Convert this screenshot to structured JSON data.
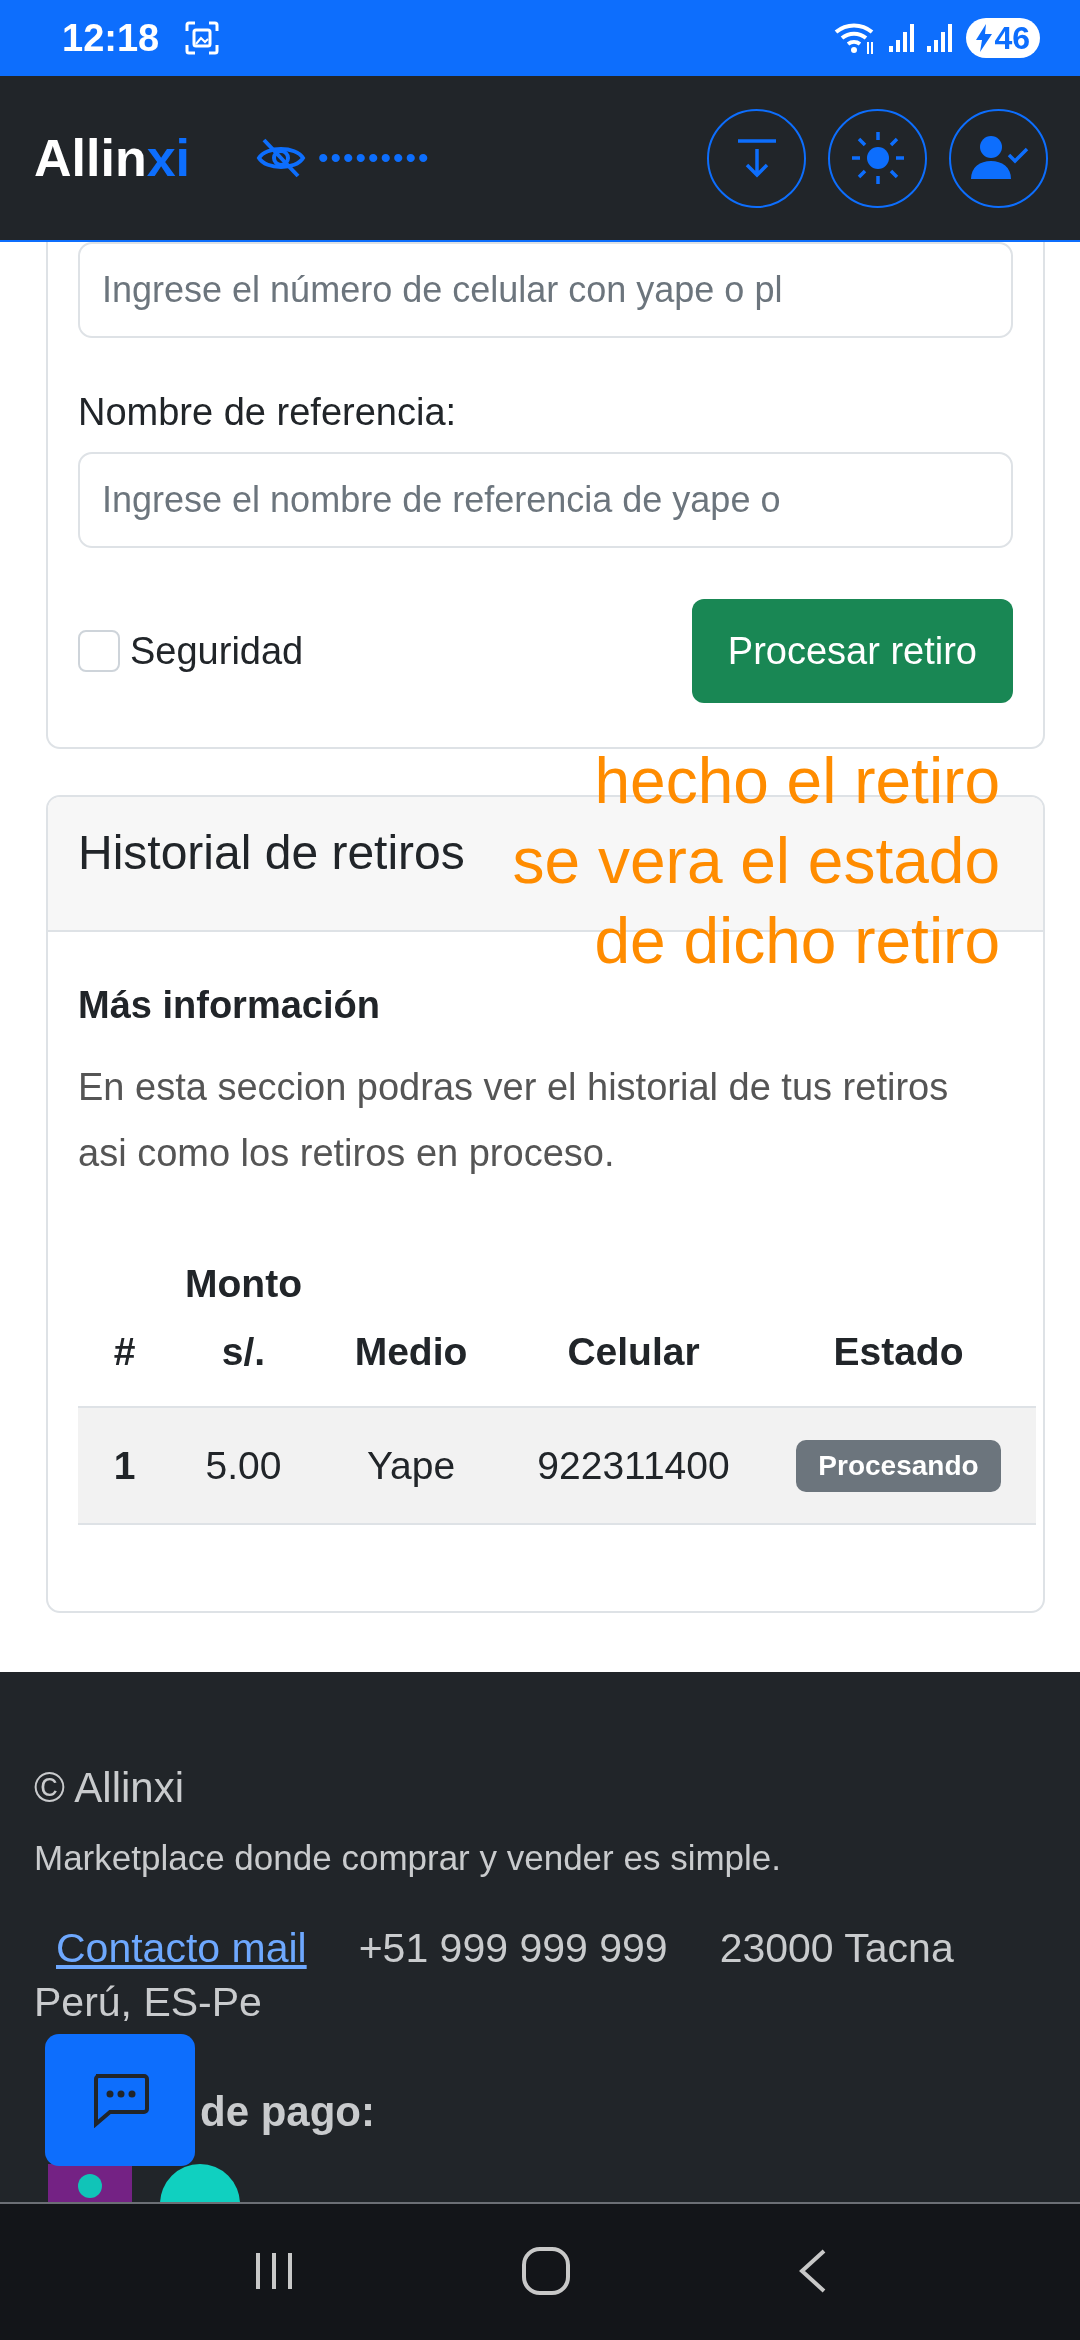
{
  "status_bar": {
    "time": "12:18",
    "battery": "46"
  },
  "header": {
    "logo": {
      "main": "Allin",
      "accent": "xi"
    },
    "masked_balance": "•••••••••"
  },
  "withdraw_form": {
    "phone_field": {
      "placeholder": "Ingrese el número de celular con yape o pl"
    },
    "reference_label": "Nombre de referencia:",
    "reference_field": {
      "placeholder": "Ingrese el nombre de referencia de yape o"
    },
    "security_checkbox": {
      "label": "Seguridad",
      "checked": false
    },
    "submit_button": "Procesar retiro"
  },
  "history": {
    "title": "Historial de retiros",
    "subtitle": "Más información",
    "description": "En esta seccion podras ver el historial de tus retiros asi como los retiros en proceso.",
    "table": {
      "columns": [
        "#",
        "Monto s/.",
        "Medio",
        "Celular",
        "Estado"
      ],
      "rows": [
        {
          "cells": [
            "1",
            "5.00",
            "Yape",
            "922311400"
          ],
          "status": "Procesando"
        }
      ]
    }
  },
  "annotation": [
    "hecho el retiro",
    "se vera el estado",
    "de dicho retiro"
  ],
  "footer": {
    "copyright": "© Allinxi",
    "tagline": "Marketplace donde comprar y vender es simple.",
    "contact_link": "Contacto mail",
    "phone": "+51 999 999 999",
    "address": "23000 Tacna",
    "country": "Perú, ES-Pe",
    "payments_title_visible": "de pago:"
  }
}
